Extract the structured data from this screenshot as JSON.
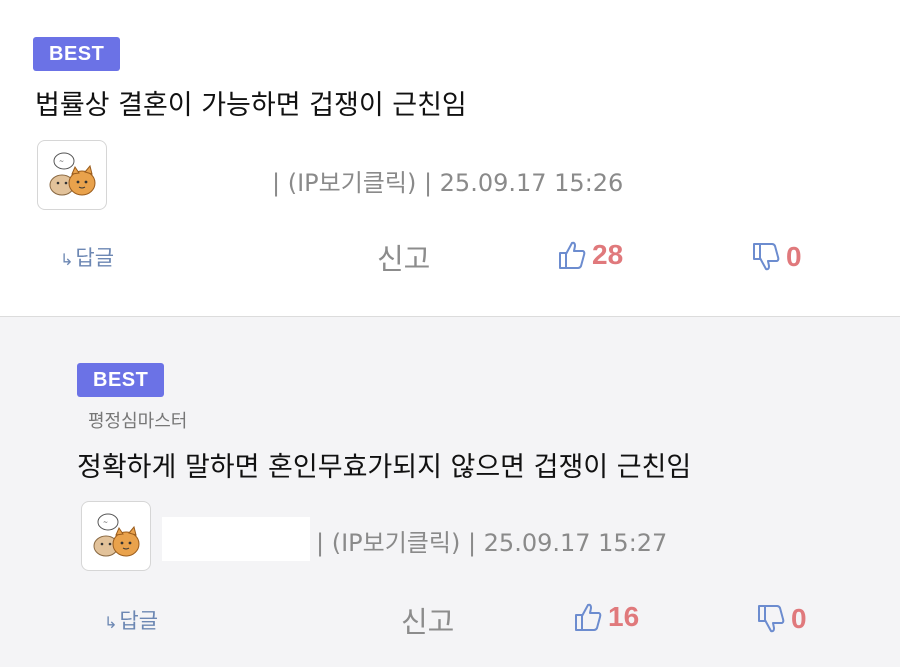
{
  "comments": [
    {
      "badge": "BEST",
      "nickname": "",
      "text": "법률상 결혼이 가능하면 겁쟁이 근친임",
      "meta": "| (IP보기클릭) | 25.09.17 15:26",
      "reply_label": "답글",
      "report_label": "신고",
      "likes": "28",
      "dislikes": "0",
      "avatar_icon": "cat-sticker-avatar-icon"
    },
    {
      "badge": "BEST",
      "nickname": "평정심마스터",
      "text": "정확하게 말하면 혼인무효가되지 않으면 겁쟁이 근친임",
      "meta": "| (IP보기클릭) | 25.09.17 15:27",
      "reply_label": "답글",
      "report_label": "신고",
      "likes": "16",
      "dislikes": "0",
      "avatar_icon": "cat-sticker-avatar-icon"
    }
  ],
  "colors": {
    "badge": "#6b72e6",
    "count": "#e0797c",
    "thumb": "#6c8ccf",
    "reply_link": "#6c87b3",
    "reply_bg": "#f4f4f6"
  }
}
